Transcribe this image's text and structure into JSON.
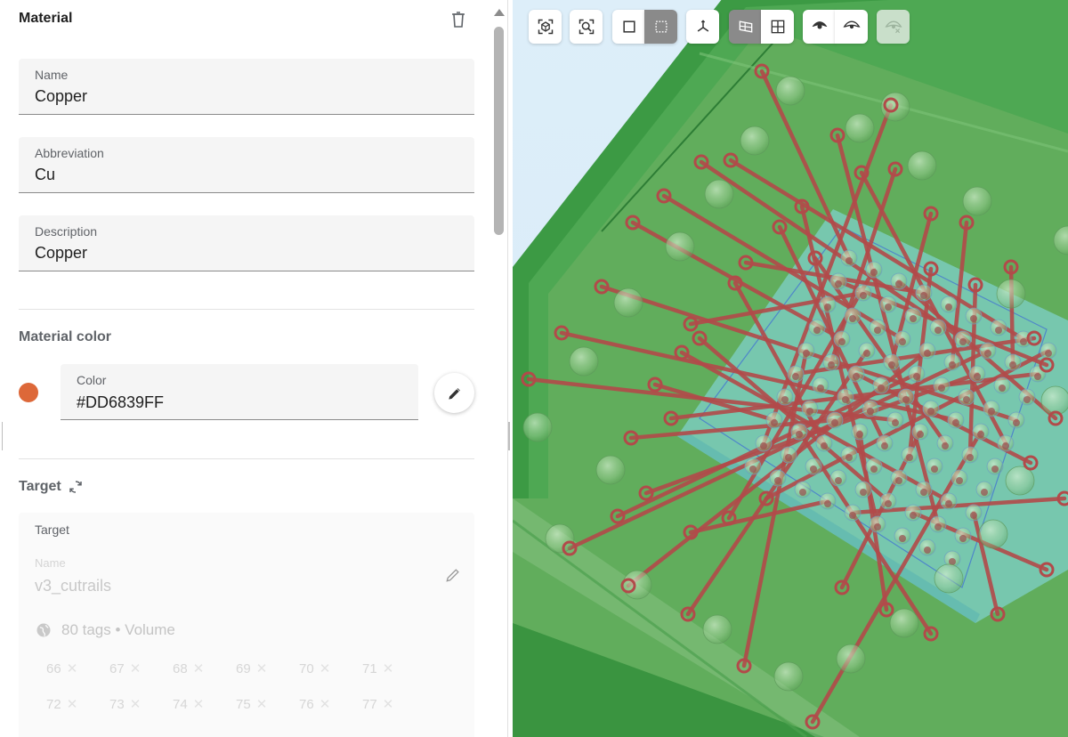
{
  "panel": {
    "title": "Material",
    "name_field": {
      "label": "Name",
      "value": "Copper"
    },
    "abbreviation_field": {
      "label": "Abbreviation",
      "value": "Cu"
    },
    "description_field": {
      "label": "Description",
      "value": "Copper"
    },
    "material_color": {
      "section_title": "Material color",
      "label": "Color",
      "value": "#DD6839FF",
      "swatch_color": "#DD6839"
    },
    "target": {
      "section_title": "Target",
      "box_label": "Target",
      "name_label": "Name",
      "name_value": "v3_cutrails",
      "summary": "80 tags • Volume",
      "tags": [
        "66",
        "67",
        "68",
        "69",
        "70",
        "71",
        "72",
        "73",
        "74",
        "75",
        "76",
        "77"
      ]
    }
  },
  "toolbar": {
    "buttons": [
      {
        "id": "fit-all",
        "icon": "fit-all-icon",
        "state": "normal"
      },
      {
        "id": "zoom-selection",
        "icon": "zoom-box-icon",
        "state": "normal"
      },
      {
        "id": "select-solid",
        "icon": "square-icon",
        "state": "normal"
      },
      {
        "id": "select-box",
        "icon": "dashed-square-icon",
        "state": "active"
      },
      {
        "id": "axes",
        "icon": "axes-icon",
        "state": "normal"
      },
      {
        "id": "split-view",
        "icon": "split-panel-icon",
        "state": "active"
      },
      {
        "id": "grid-view",
        "icon": "grid-icon",
        "state": "normal"
      },
      {
        "id": "show-all",
        "icon": "eye-icon",
        "state": "normal"
      },
      {
        "id": "show-selection",
        "icon": "eye-outline-icon",
        "state": "normal"
      },
      {
        "id": "hide",
        "icon": "eye-slash-icon",
        "state": "disabled"
      }
    ]
  },
  "colors": {
    "accent": "#DD6839",
    "board_green": "#5fa85d",
    "board_edge": "#3d8f42",
    "chip_cyan": "#7fd0c9",
    "trace": "#b24a4a"
  }
}
